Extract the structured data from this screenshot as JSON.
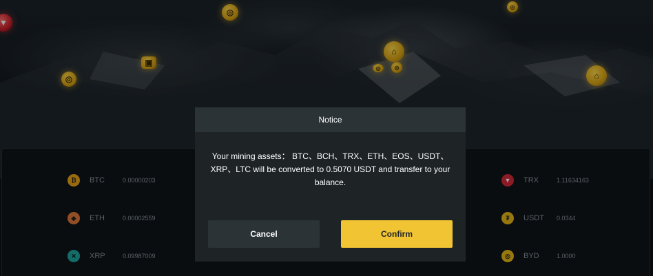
{
  "modal": {
    "title": "Notice",
    "message": "Your mining assets： BTC、BCH、TRX、ETH、EOS、USDT、XRP、LTC will be converted to 0.5070 USDT and transfer to your balance.",
    "cancel_label": "Cancel",
    "confirm_label": "Confirm"
  },
  "assets": {
    "left": [
      {
        "symbol": "BTC",
        "amount": "0.00000203",
        "icon": "bitcoin-icon",
        "color": "#e8a317"
      },
      {
        "symbol": "ETH",
        "amount": "0.00002559",
        "icon": "ethereum-icon",
        "color": "#e07a3a"
      },
      {
        "symbol": "XRP",
        "amount": "0.09987009",
        "icon": "ripple-icon",
        "color": "#1fa7a0"
      }
    ],
    "right": [
      {
        "symbol": "TRX",
        "amount": "1.11634163",
        "icon": "tron-icon",
        "color": "#d8283a"
      },
      {
        "symbol": "USDT",
        "amount": "0.0344",
        "icon": "tether-icon",
        "color": "#e8b817"
      },
      {
        "symbol": "BYD",
        "amount": "1.0000",
        "icon": "byd-coin-icon",
        "color": "#e8b817"
      }
    ]
  },
  "colors": {
    "accent": "#f0c433",
    "modal_bg": "#1e2326",
    "modal_header": "#2b3336"
  }
}
